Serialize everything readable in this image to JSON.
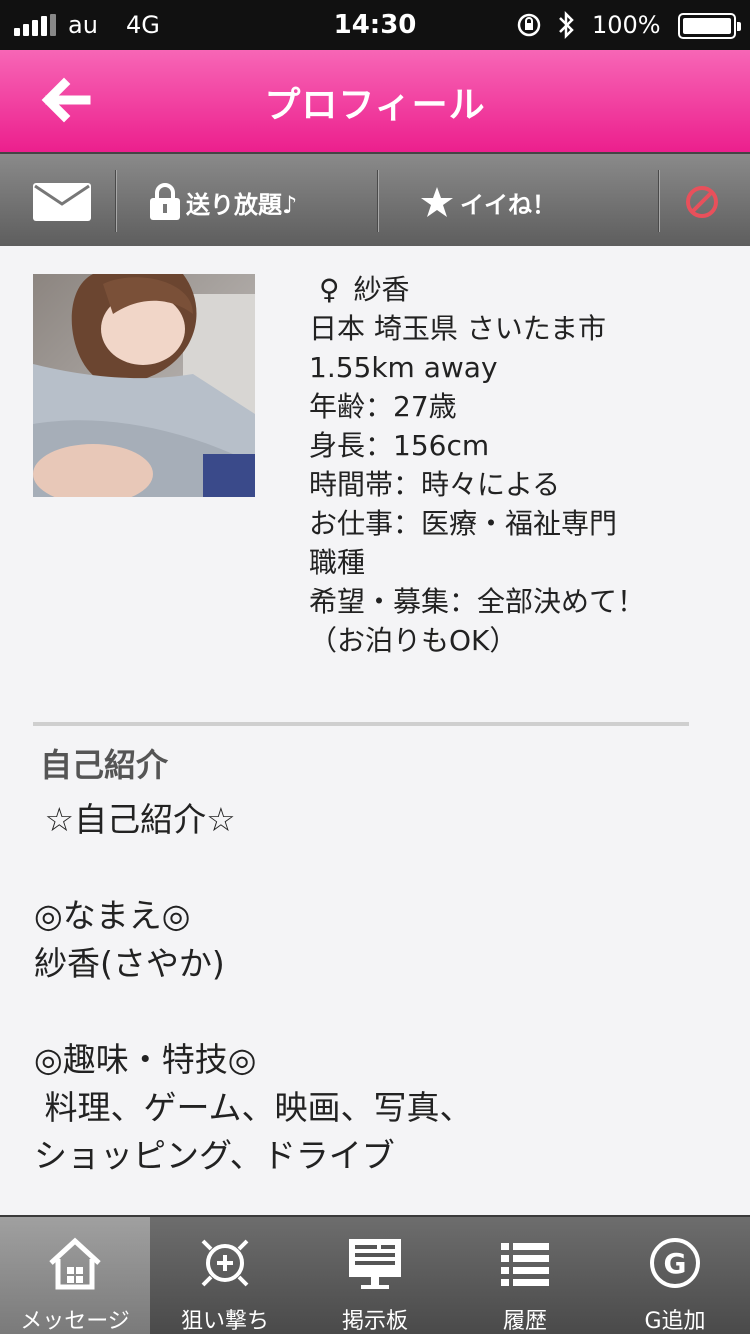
{
  "status_bar": {
    "carrier": "au",
    "network": "4G",
    "time": "14:30",
    "battery": "100%"
  },
  "header": {
    "title": "プロフィール"
  },
  "actions": {
    "send_label": "送り放題♪",
    "like_label": "イイね！"
  },
  "profile": {
    "gender_symbol": "♀",
    "name": "紗香",
    "location": "日本 埼玉県 さいたま市",
    "distance": "1.55km away",
    "age": "年齢：27歳",
    "height": "身長：156cm",
    "time_zone": "時間帯：時々による",
    "job_line1": "お仕事：医療・福祉専門",
    "job_line2": "職種",
    "wish_line1": "希望・募集：全部決めて！",
    "wish_line2": "（お泊りもOK）"
  },
  "intro": {
    "title": "自己紹介",
    "body": " ☆自己紹介☆\n\n◎なまえ◎\n紗香(さやか)\n\n◎趣味・特技◎\n 料理、ゲーム、映画、写真、\nショッピング、ドライブ"
  },
  "tabs": [
    {
      "label": "メッセージ",
      "icon": "home-icon"
    },
    {
      "label": "狙い撃ち",
      "icon": "target-icon"
    },
    {
      "label": "掲示板",
      "icon": "board-icon"
    },
    {
      "label": "履歴",
      "icon": "list-icon"
    },
    {
      "label": "G追加",
      "icon": "g-add-icon"
    }
  ],
  "colors": {
    "header_pink": "#ec1f8d",
    "block_red": "#e8505b"
  }
}
